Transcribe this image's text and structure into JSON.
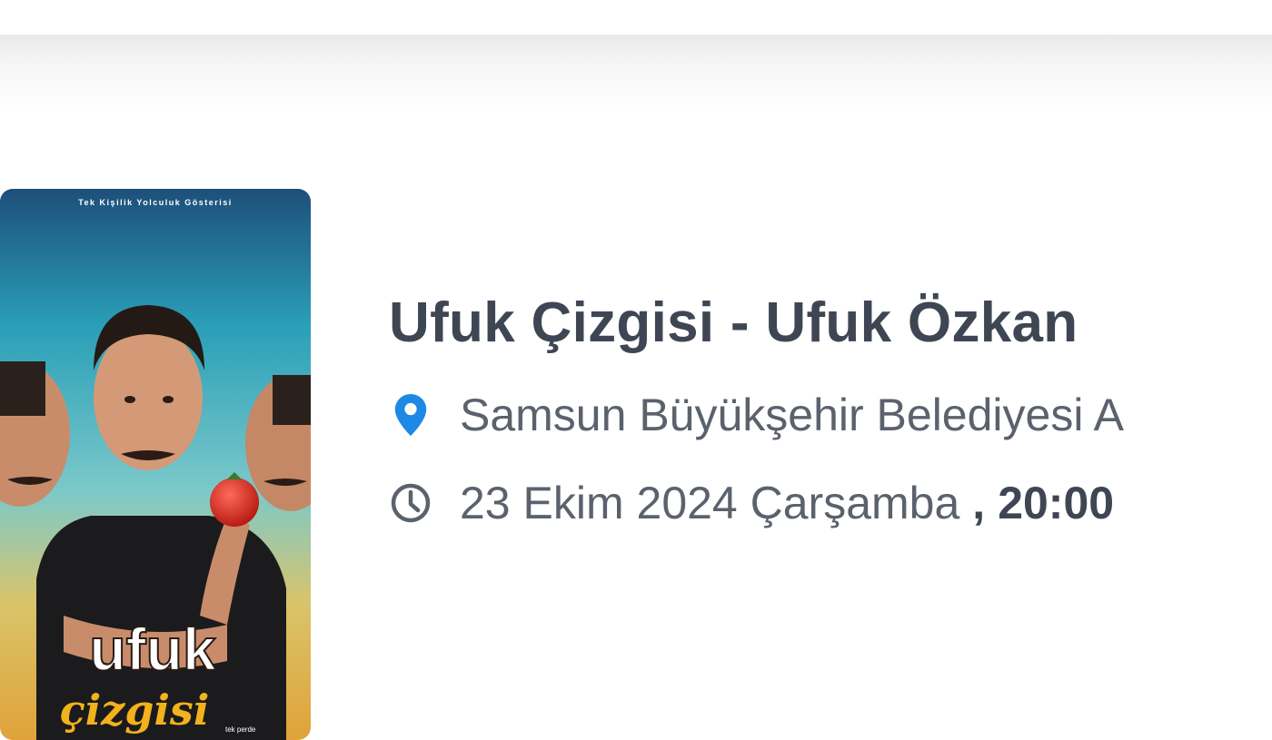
{
  "event": {
    "title": "Ufuk Çizgisi - Ufuk Özkan",
    "venue": "Samsun Büyükşehir Belediyesi A",
    "date": "23 Ekim 2024 Çarşamba",
    "time_separator": ",",
    "time": "20:00",
    "poster": {
      "tagline": "Tek Kişilik Yolculuk Gösterisi",
      "logo_main": "ufuk",
      "logo_sub": "çizgisi",
      "logo_small": "tek perde"
    }
  },
  "icons": {
    "venue": "location-pin-icon",
    "date": "clock-icon"
  },
  "colors": {
    "title": "#3f4653",
    "meta_text": "#5b626d",
    "location_pin": "#1e88e5",
    "clock": "#5b626d"
  }
}
